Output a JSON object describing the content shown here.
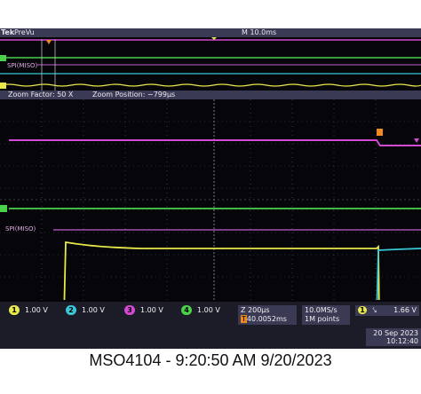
{
  "brand": "Tek",
  "header": {
    "mode": "PreVu",
    "timebase": "M 10.0ms"
  },
  "zoom": {
    "factor_label": "Zoom Factor: 50 X",
    "position_label": "Zoom Position: −799µs"
  },
  "bus_label": "SPI(MISO)",
  "trigger_marker": "T",
  "channels": [
    {
      "num": "1",
      "scale": "1.00 V",
      "color": "#e8e84a"
    },
    {
      "num": "2",
      "scale": "1.00 V",
      "color": "#38c8d8"
    },
    {
      "num": "3",
      "scale": "1.00 V",
      "color": "#d24ad2"
    },
    {
      "num": "4",
      "scale": "1.00 V",
      "color": "#4ad24a"
    }
  ],
  "horizontal": {
    "zoom_scale": "Z 200µs",
    "trigger_pos": "40.0052ms"
  },
  "acquisition": {
    "rate": "10.0MS/s",
    "points": "1M points"
  },
  "trigger": {
    "channel": "1",
    "slope": "falling",
    "level": "1.66 V"
  },
  "datetime": {
    "date": "20 Sep 2023",
    "time": "10:12:40"
  },
  "caption": "MSO4104 - 9:20:50 AM   9/20/2023"
}
